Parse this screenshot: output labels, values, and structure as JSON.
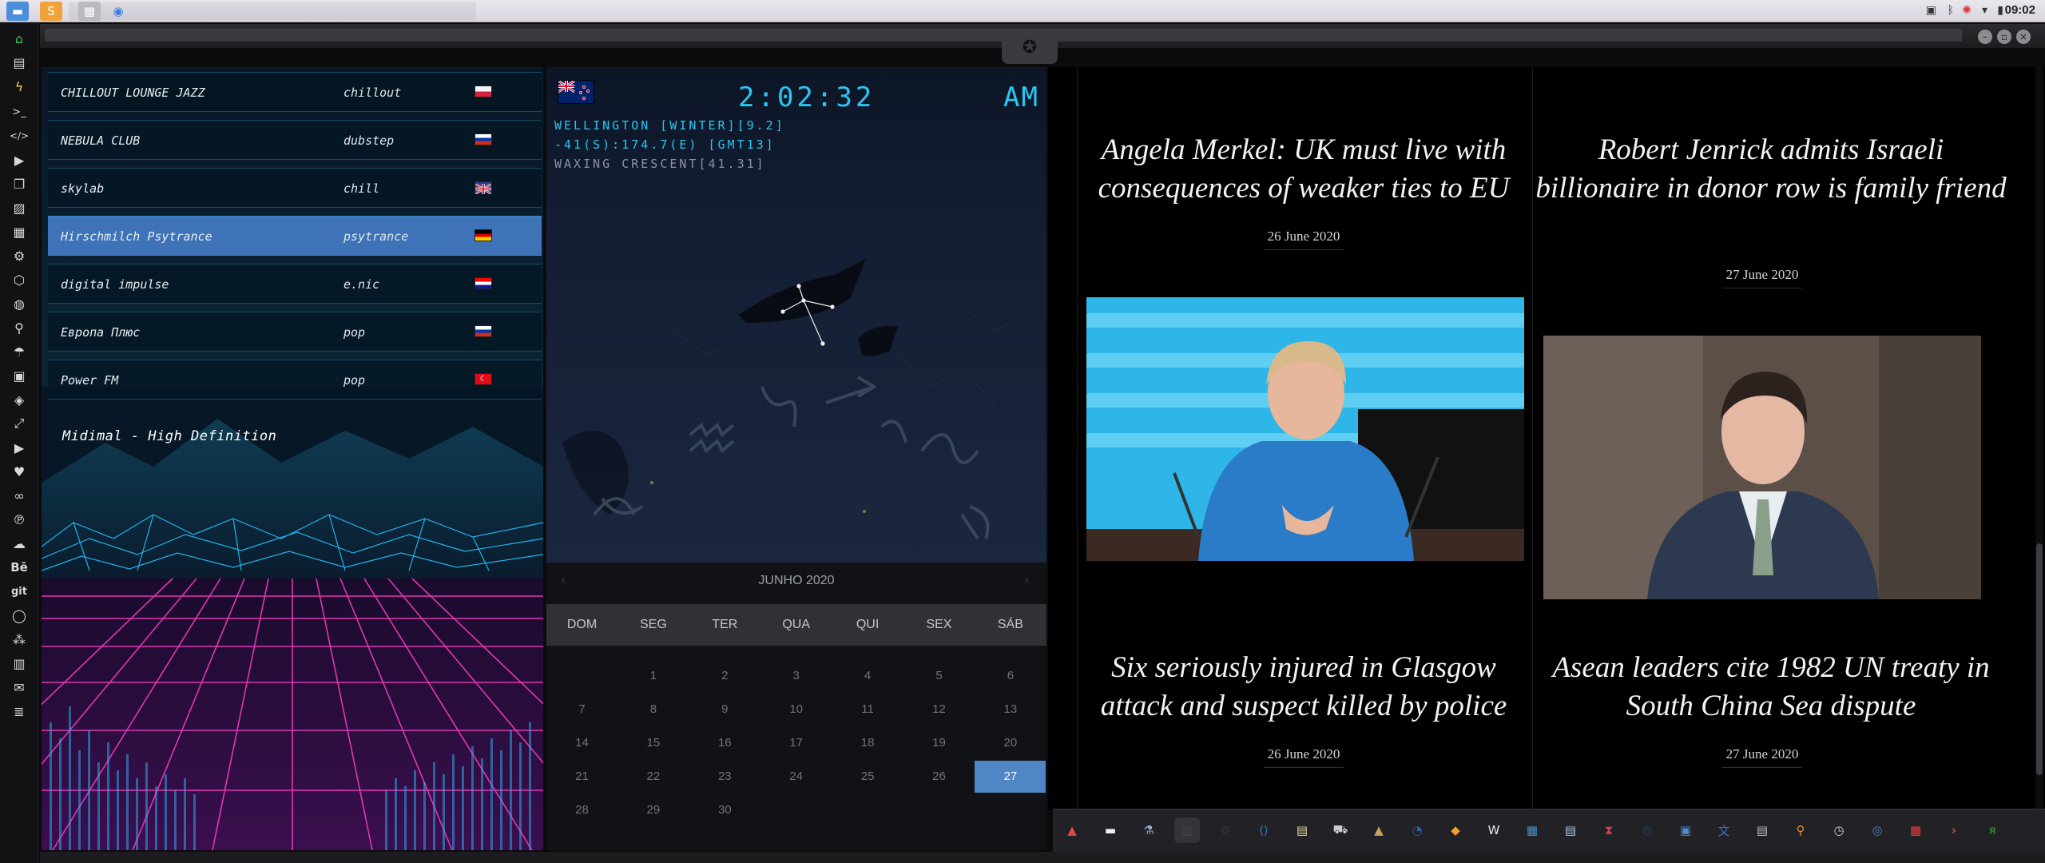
{
  "system": {
    "clock": "09:02"
  },
  "radio": {
    "stations": [
      {
        "name": "CHILLOUT LOUNGE JAZZ",
        "genre": "chillout",
        "flag": "poland"
      },
      {
        "name": "NEBULA CLUB",
        "genre": "dubstep",
        "flag": "russia"
      },
      {
        "name": "skylab",
        "genre": "chill",
        "flag": "uk"
      },
      {
        "name": "Hirschmilch Psytrance",
        "genre": "psytrance",
        "flag": "germany"
      },
      {
        "name": "digital impulse",
        "genre": "e.nic",
        "flag": "croatia"
      },
      {
        "name": "Европа Плюс",
        "genre": "pop",
        "flag": "russia"
      },
      {
        "name": "Power FM",
        "genre": "pop",
        "flag": "turkey"
      }
    ],
    "active_index": 3,
    "now_playing": "Midimal - High Definition"
  },
  "world_clock": {
    "time": "2:02:32",
    "ampm": "AM",
    "location_line": "WELLINGTON [WINTER][9.2]",
    "coords_line": "-41(S):174.7(E) [GMT13]",
    "moon_line": "WAXING CRESCENT[41.31]",
    "flag": "new-zealand"
  },
  "calendar": {
    "month": "JUNHO 2020",
    "weekdays": [
      "DOM",
      "SEG",
      "TER",
      "QUA",
      "QUI",
      "SEX",
      "SÁB"
    ],
    "weeks": [
      [
        "",
        "1",
        "2",
        "3",
        "4",
        "5",
        "6"
      ],
      [
        "7",
        "8",
        "9",
        "10",
        "11",
        "12",
        "13"
      ],
      [
        "14",
        "15",
        "16",
        "17",
        "18",
        "19",
        "20"
      ],
      [
        "21",
        "22",
        "23",
        "24",
        "25",
        "26",
        "27"
      ],
      [
        "28",
        "29",
        "30",
        "",
        "",
        "",
        ""
      ]
    ],
    "selected": "27"
  },
  "news": {
    "articles": [
      {
        "headline": "Angela Merkel: UK must live with consequences of weaker ties to EU",
        "date": "26 June 2020"
      },
      {
        "headline": "Robert Jenrick admits Israeli billionaire in donor row is family friend",
        "date": "27 June 2020"
      },
      {
        "headline": "Six seriously injured in Glasgow attack and suspect killed by police",
        "date": "26 June 2020"
      },
      {
        "headline": "Asean leaders cite 1982 UN treaty in South China Sea dispute",
        "date": "27 June 2020"
      }
    ]
  },
  "left_dock": {
    "text_icons": [
      "Bē",
      "git"
    ]
  },
  "dock_icons": [
    "vivaldi-icon",
    "terminal-icon",
    "flask-icon",
    "files-icon",
    "settings-icon",
    "vscode-icon",
    "notes-icon",
    "truck-icon",
    "pyramid-icon",
    "app-icon",
    "palette-icon",
    "wikipedia-icon",
    "calculator-icon",
    "document-icon",
    "hourglass-icon",
    "globe-dark-icon",
    "photos-icon",
    "translate-icon",
    "news-icon",
    "search-icon",
    "clock-icon",
    "web-icon",
    "calendar-icon",
    "arrow-icon",
    "yandex-icon"
  ],
  "colors": {
    "accent_cyan": "#29c7f2",
    "active_station": "#3e73b8",
    "calendar_selected": "#4f86c6"
  }
}
